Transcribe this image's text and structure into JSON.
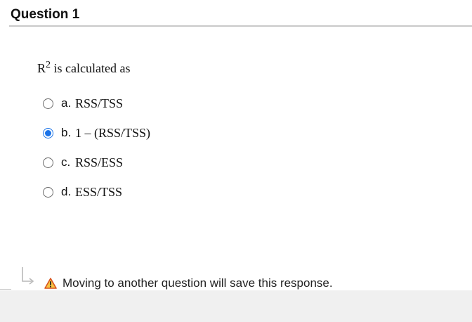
{
  "question": {
    "title": "Question 1",
    "text_prefix": "R",
    "text_sup": "2",
    "text_rest": " is calculated as"
  },
  "choices": [
    {
      "letter": "a.",
      "text": "RSS/TSS",
      "selected": false
    },
    {
      "letter": "b.",
      "text": "1 – (RSS/TSS)",
      "selected": true
    },
    {
      "letter": "c.",
      "text": "RSS/ESS",
      "selected": false
    },
    {
      "letter": "d.",
      "text": "ESS/TSS",
      "selected": false
    }
  ],
  "footer": {
    "notice": "Moving to another question will save this response.",
    "icons": [
      "nav-arrow-icon",
      "warning-icon"
    ]
  },
  "colors": {
    "accent": "#1a73e8",
    "warning": "#e8a21a",
    "footer_bg": "#f0f0f0"
  }
}
